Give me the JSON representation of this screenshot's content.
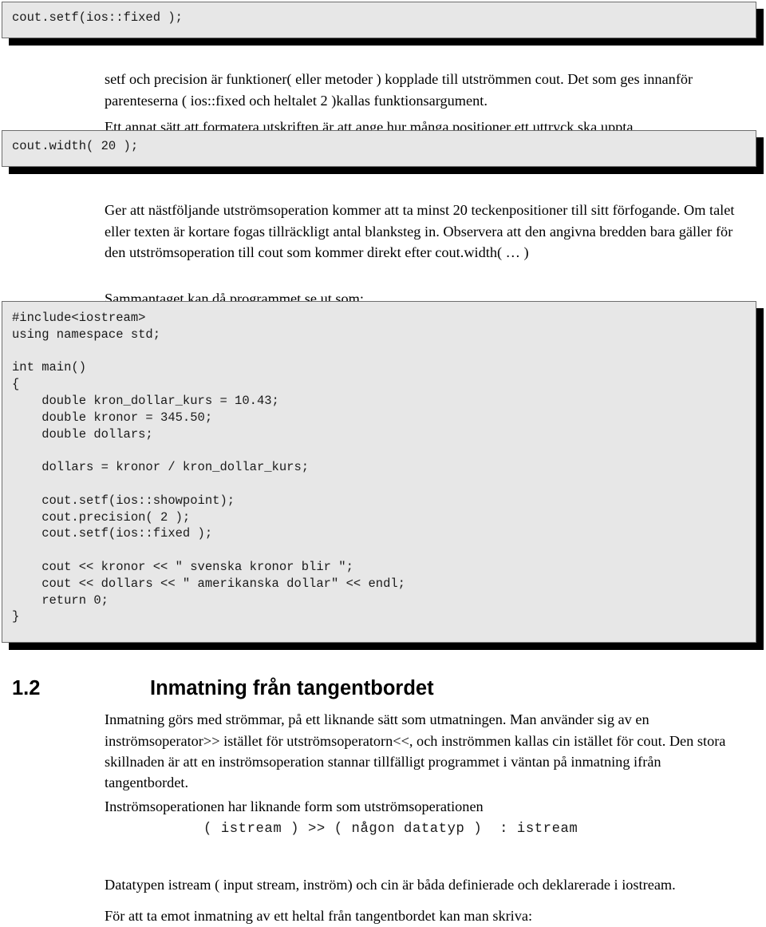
{
  "document": {
    "language": "sv",
    "page_background": "#ffffff",
    "code_box_fill": "#e7e7e7",
    "code_box_border": "#6e6e6e",
    "code_shadow": "#000000"
  },
  "code_boxes": {
    "setf": {
      "label": "cout-setf-fixed",
      "text": "cout.setf(ios::fixed );"
    },
    "width": {
      "label": "cout-width-20",
      "text": "cout.width( 20 );"
    },
    "program": {
      "label": "complete-program",
      "text": "#include<iostream>\nusing namespace std;\n\nint main()\n{\n    double kron_dollar_kurs = 10.43;\n    double kronor = 345.50;\n    double dollars;\n\n    dollars = kronor / kron_dollar_kurs;\n\n    cout.setf(ios::showpoint);\n    cout.precision( 2 );\n    cout.setf(ios::fixed );\n\n    cout << kronor << \" svenska kronor blir \";\n    cout << dollars << \" amerikanska dollar\" << endl;\n    return 0;\n}"
    }
  },
  "paragraphs": {
    "setf_desc": "setf och precision är funktioner( eller metoder ) kopplade till utströmmen cout. Det som ges innanför parenteserna ( ios::fixed och heltalet 2 )kallas funktionsargument.",
    "annat_satt": "Ett annat sätt att formatera utskriften är att ange hur många positioner ett uttryck ska uppta.",
    "ger_att": "Ger att nästföljande utströmsoperation kommer att ta minst 20 teckenpositioner till sitt förfogande. Om talet eller texten är kortare fogas tillräckligt antal blanksteg in. Observera att den angivna bredden bara gäller för den utströmsoperation till cout som kommer direkt efter cout.width( … )",
    "sammantaget": "Sammantaget kan då programmet se ut som:",
    "inmatning_gors": "Inmatning görs med strömmar, på ett liknande sätt som utmatningen. Man använder sig av en inströmsoperator>> istället för utströmsoperatorn<<, och inströmmen kallas cin istället för cout. Den stora skillnaden är att en inströmsoperation stannar tillfälligt programmet i väntan på inmatning ifrån tangentbordet.",
    "instroms_form": "Inströmsoperationen har liknande form som utströmsoperationen",
    "datatypen": "Datatypen istream ( input stream, inström) och cin är båda definierade och deklarerade i iostream.",
    "for_att_ta": "För att ta emot inmatning av ett heltal från tangentbordet kan man skriva:"
  },
  "section": {
    "number": "1.2",
    "title": "Inmatning från tangentbordet"
  },
  "form_line": {
    "text": "( istream ) >> ( någon datatyp )  : istream"
  }
}
